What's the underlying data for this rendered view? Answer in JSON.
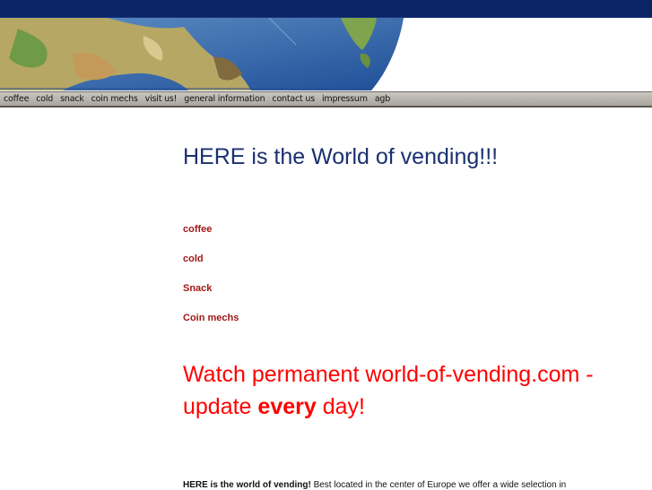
{
  "nav": {
    "items": [
      "coffee",
      "cold",
      "snack",
      "coin mechs",
      "visit us!",
      "general information",
      "contact us",
      "impressum",
      "agb"
    ]
  },
  "main": {
    "headline": "HERE is the World of vending!!!",
    "categories": [
      "coffee",
      "cold",
      "Snack",
      "Coin mechs"
    ],
    "promo": {
      "part1": "Watch permanent world-of-vending.com - update ",
      "bold": "every",
      "part2": " day!"
    },
    "intro": {
      "bold": "HERE is the world of vending!",
      "text": " Best located in the center of Europe we offer a wide selection in"
    }
  },
  "colors": {
    "top_bar": "#0a2466",
    "headline": "#1a3070",
    "category_link": "#a01818",
    "promo": "#ff0000"
  }
}
